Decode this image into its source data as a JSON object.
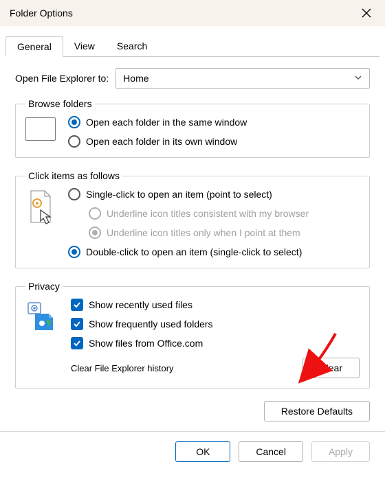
{
  "title": "Folder Options",
  "tabs": {
    "general": "General",
    "view": "View",
    "search": "Search"
  },
  "open_to": {
    "label": "Open File Explorer to:",
    "value": "Home"
  },
  "browse": {
    "legend": "Browse folders",
    "same_window": "Open each folder in the same window",
    "own_window": "Open each folder in its own window"
  },
  "click": {
    "legend": "Click items as follows",
    "single": "Single-click to open an item (point to select)",
    "underline_browser": "Underline icon titles consistent with my browser",
    "underline_point": "Underline icon titles only when I point at them",
    "double": "Double-click to open an item (single-click to select)"
  },
  "privacy": {
    "legend": "Privacy",
    "recent": "Show recently used files",
    "frequent": "Show frequently used folders",
    "office": "Show files from Office.com",
    "clear_label": "Clear File Explorer history",
    "clear_btn": "Clear"
  },
  "restore": "Restore Defaults",
  "footer": {
    "ok": "OK",
    "cancel": "Cancel",
    "apply": "Apply"
  }
}
